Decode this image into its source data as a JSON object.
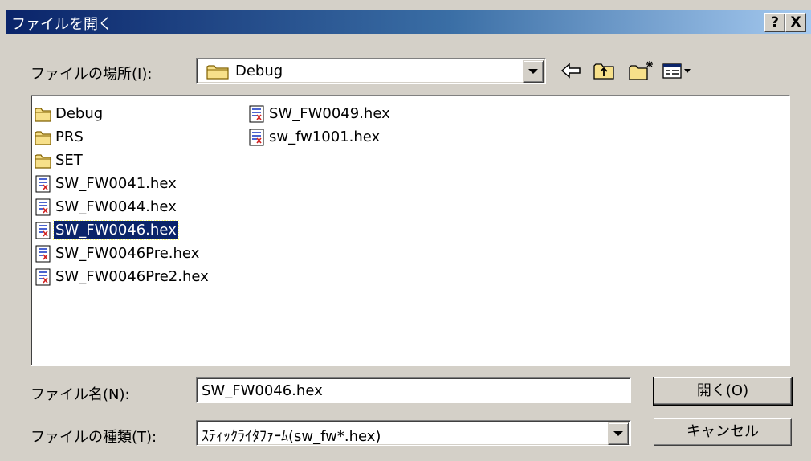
{
  "window": {
    "title": "ファイルを開く",
    "help_button": "?",
    "close_button": "X"
  },
  "location": {
    "label": "ファイルの場所(I):",
    "value": "Debug"
  },
  "toolbar": {
    "icons": [
      "back-icon",
      "up-folder-icon",
      "new-folder-icon",
      "view-menu-icon"
    ]
  },
  "files": {
    "column1": [
      {
        "name": "Debug",
        "type": "folder"
      },
      {
        "name": "PRS",
        "type": "folder"
      },
      {
        "name": "SET",
        "type": "folder"
      },
      {
        "name": "SW_FW0041.hex",
        "type": "file"
      },
      {
        "name": "SW_FW0044.hex",
        "type": "file"
      },
      {
        "name": "SW_FW0046.hex",
        "type": "file",
        "selected": true
      },
      {
        "name": "SW_FW0046Pre.hex",
        "type": "file"
      },
      {
        "name": "SW_FW0046Pre2.hex",
        "type": "file"
      }
    ],
    "column2": [
      {
        "name": "SW_FW0049.hex",
        "type": "file"
      },
      {
        "name": "sw_fw1001.hex",
        "type": "file"
      }
    ]
  },
  "filename": {
    "label": "ファイル名(N):",
    "value": "SW_FW0046.hex"
  },
  "filetype": {
    "label": "ファイルの種類(T):",
    "value": "ｽﾃｨｯｸﾗｲﾀﾌｧｰﾑ(sw_fw*.hex)"
  },
  "buttons": {
    "open": "開く(O)",
    "cancel": "キャンセル"
  },
  "colors": {
    "dialog_bg": "#d4d0c8",
    "titlebar_start": "#0a246a",
    "titlebar_end": "#a6caf0",
    "selection": "#0a246a",
    "folder": "#f7e08a"
  }
}
